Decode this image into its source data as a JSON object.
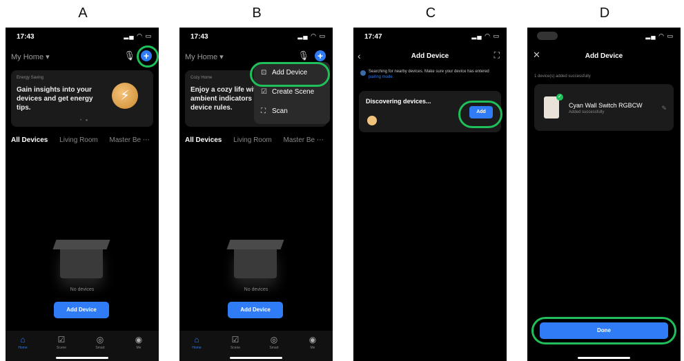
{
  "panels": {
    "a": {
      "letter": "A",
      "time": "17:43",
      "home_selector": "My Home ▾",
      "card_tag": "Energy Saving",
      "card_text": "Gain insights into your devices and get energy tips.",
      "tabs": [
        "All Devices",
        "Living Room",
        "Master Be ⋯"
      ],
      "empty_label": "No devices",
      "add_device_button": "Add Device",
      "tabbar": [
        "Home",
        "Scene",
        "Smart",
        "Me"
      ]
    },
    "b": {
      "letter": "B",
      "time": "17:43",
      "home_selector": "My Home ▾",
      "card_tag": "Cozy Home",
      "card_text": "Enjoy a cozy life with ambient indicators and device rules.",
      "menu": [
        "Add Device",
        "Create Scene",
        "Scan"
      ],
      "tabs": [
        "All Devices",
        "Living Room",
        "Master Be ⋯"
      ],
      "empty_label": "No devices",
      "add_device_button": "Add Device",
      "tabbar": [
        "Home",
        "Scene",
        "Smart",
        "Me"
      ]
    },
    "c": {
      "letter": "C",
      "time": "17:47",
      "title": "Add Device",
      "search_text": "Searching for nearby devices. Make sure your device has entered",
      "search_link": "pairing mode.",
      "discovering": "Discovering devices...",
      "add_button": "Add"
    },
    "d": {
      "letter": "D",
      "title": "Add Device",
      "success_count": "1 device(s) added successfully",
      "device_name": "Cyan Wall Switch RGBCW",
      "device_status": "Added successfully",
      "done_button": "Done"
    }
  },
  "colors": {
    "accent": "#2f7cf6",
    "highlight": "#1fbf5a"
  },
  "icons": {
    "mic": "microphone-icon",
    "plus": "plus-icon",
    "back": "chevron-left-icon",
    "scan": "scan-icon",
    "close": "close-icon",
    "edit": "edit-icon"
  }
}
